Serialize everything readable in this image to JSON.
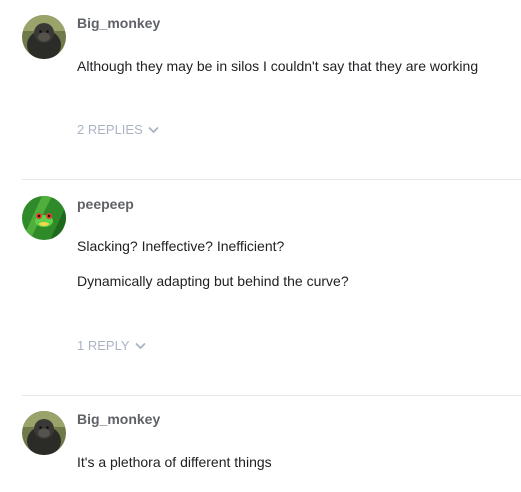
{
  "comments": [
    {
      "author": "Big_monkey",
      "avatar_icon": "gorilla-avatar",
      "paragraphs": [
        "Although they may be in silos I couldn't say that they are working"
      ],
      "replies_label": "2 REPLIES"
    },
    {
      "author": "peepeep",
      "avatar_icon": "frog-avatar",
      "paragraphs": [
        "Slacking? Ineffective? Inefficient?",
        "Dynamically adapting but behind the curve?"
      ],
      "replies_label": "1 REPLY"
    },
    {
      "author": "Big_monkey",
      "avatar_icon": "gorilla-avatar",
      "paragraphs": [
        "It's a plethora of different things"
      ]
    }
  ],
  "colors": {
    "author": "#5f6368",
    "text": "#202124",
    "replies": "#aab3c5",
    "divider": "#e6e7ea"
  }
}
